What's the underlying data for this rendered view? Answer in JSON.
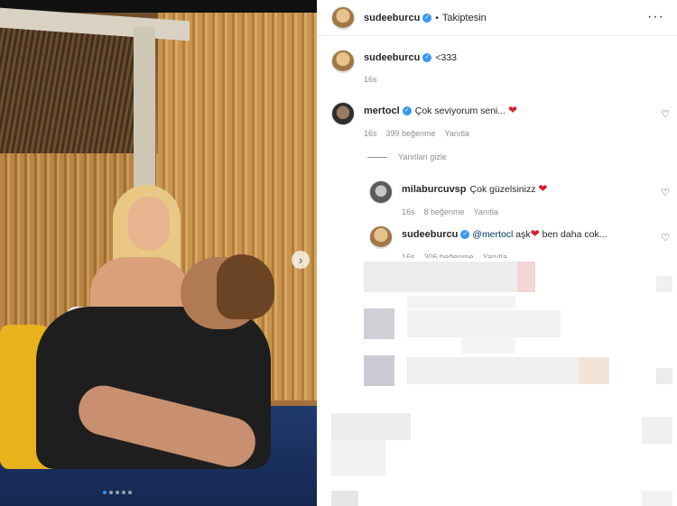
{
  "post": {
    "author": "sudeeburcu",
    "follow_status": "Takiptesin",
    "separator": "•",
    "more_icon": "more-horizontal-icon",
    "carousel": {
      "total": 5,
      "current": 1
    }
  },
  "caption": {
    "username": "sudeeburcu",
    "text": "<333",
    "time": "16s"
  },
  "comments": [
    {
      "username": "mertocl",
      "text": "Çok seviyorum seni...",
      "time": "16s",
      "likes": "399 beğenme",
      "reply": "Yanıtla"
    }
  ],
  "hide_replies": "Yanıtları gizle",
  "replies": [
    {
      "username": "milaburcuvsp",
      "text": "Çok güzelsinizz",
      "time": "16s",
      "likes": "8 beğenme",
      "reply": "Yanıtla"
    },
    {
      "username": "sudeeburcu",
      "mention": "@mertocl",
      "text_after": "aşk",
      "text_end": "ben daha cok...",
      "time": "16s",
      "likes": "306 beğenme",
      "reply": "Yanıtla"
    }
  ],
  "colors": {
    "verified": "#3897f0",
    "heart": "#d61f33",
    "secondary_text": "#8e8e8e",
    "carousel_active": "#3b8cf0"
  }
}
